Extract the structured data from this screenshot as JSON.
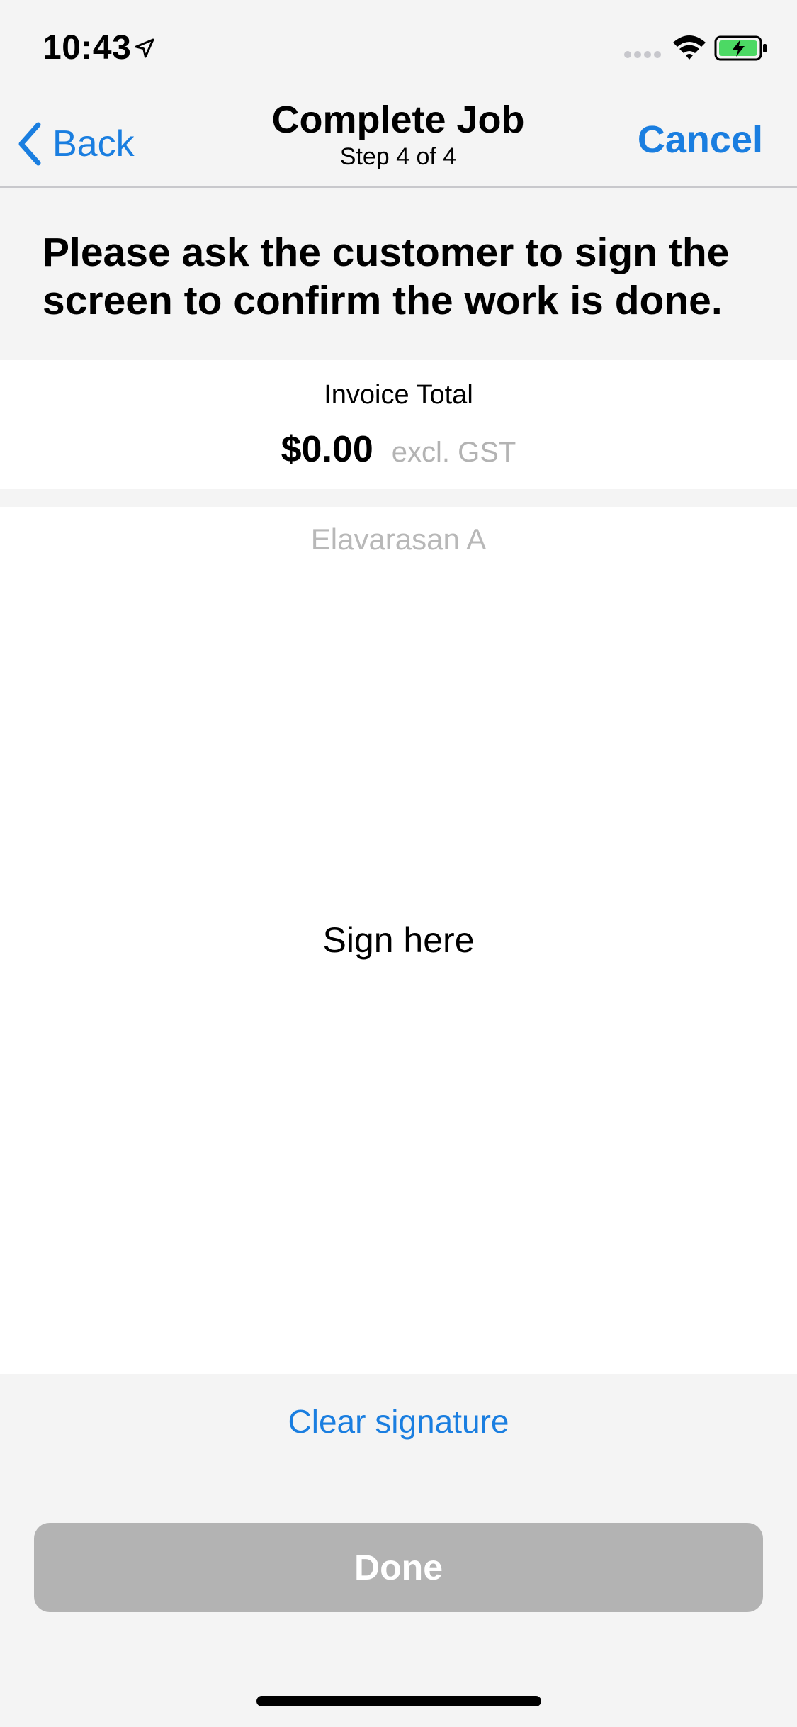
{
  "status_bar": {
    "time": "10:43",
    "icons": [
      "location-arrow-icon",
      "cellular-signal-icon",
      "wifi-icon",
      "battery-charging-icon"
    ],
    "battery_color": "#4cd964"
  },
  "nav": {
    "back_label": "Back",
    "title": "Complete Job",
    "subtitle": "Step 4 of 4",
    "cancel_label": "Cancel",
    "accent_color": "#1a7ee0"
  },
  "instruction": "Please ask the customer to sign the screen to confirm the work is done.",
  "invoice": {
    "label": "Invoice Total",
    "amount": "$0.00",
    "tax_note": "excl. GST"
  },
  "signature": {
    "signer_name": "Elavarasan A",
    "prompt": "Sign here",
    "clear_label": "Clear signature"
  },
  "actions": {
    "done_label": "Done",
    "done_color": "#b3b3b3"
  }
}
